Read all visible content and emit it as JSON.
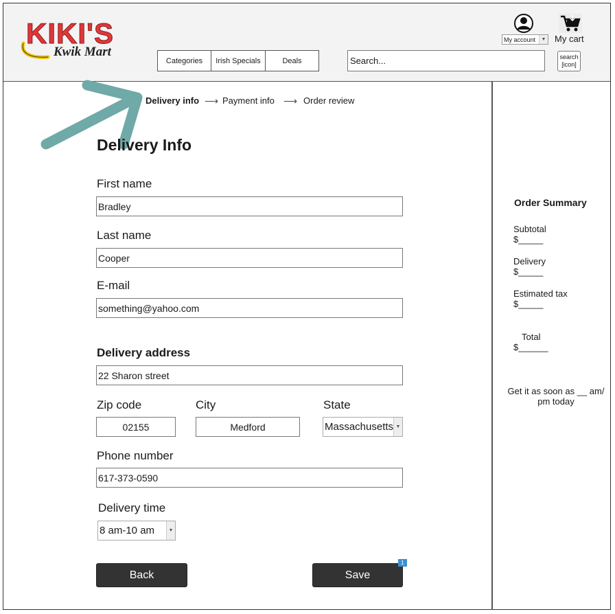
{
  "logo": {
    "name": "KIKI'S",
    "tagline": "Kwik Mart"
  },
  "nav": {
    "categories": "Categories",
    "irish_specials": "Irish Specials",
    "deals": "Deals"
  },
  "search": {
    "placeholder": "Search...",
    "button_line1": "search",
    "button_line2": "[icon]"
  },
  "account": {
    "label": "My account"
  },
  "cart": {
    "label": "My cart"
  },
  "steps": {
    "step1": "Delivery info",
    "step2": "Payment info",
    "step3": "Order review",
    "active": "Delivery info"
  },
  "form": {
    "title": "Delivery Info",
    "first_name_label": "First name",
    "first_name_value": "Bradley",
    "last_name_label": "Last name",
    "last_name_value": "Cooper",
    "email_label": "E-mail",
    "email_value": "something@yahoo.com",
    "address_label": "Delivery address",
    "address_value": "22 Sharon street",
    "zip_label": "Zip code",
    "zip_value": "02155",
    "city_label": "City",
    "city_value": "Medford",
    "state_label": "State",
    "state_value": "Massachusetts",
    "phone_label": "Phone number",
    "phone_value": "617-373-0590",
    "time_label": "Delivery time",
    "time_value": "8 am-10 am"
  },
  "buttons": {
    "back": "Back",
    "save": "Save",
    "save_badge": "1"
  },
  "summary": {
    "title": "Order Summary",
    "subtotal_label": "Subtotal",
    "subtotal_value": "$_____",
    "delivery_label": "Delivery",
    "delivery_value": "$_____",
    "tax_label": "Estimated tax",
    "tax_value": "$_____",
    "total_label": "Total",
    "total_value": "$______",
    "eta_line1": "Get it as soon as __ am/",
    "eta_line2": "pm today"
  },
  "colors": {
    "annotation_arrow": "#6fa9a8",
    "logo_red": "#e0373a",
    "button_dark": "#333333",
    "badge_blue": "#3b8fd4"
  }
}
